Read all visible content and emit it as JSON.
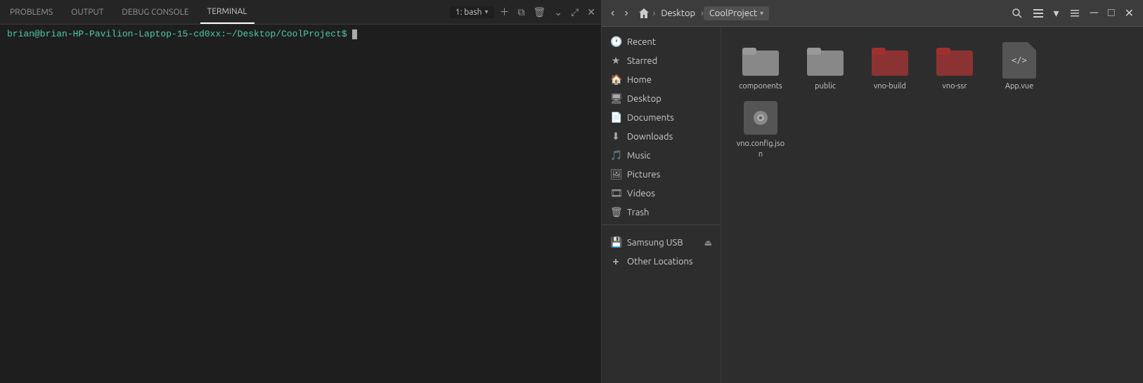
{
  "vscode": {
    "tabs": [
      {
        "label": "PROBLEMS",
        "active": false
      },
      {
        "label": "OUTPUT",
        "active": false
      },
      {
        "label": "DEBUG CONSOLE",
        "active": false
      },
      {
        "label": "TERMINAL",
        "active": true
      }
    ],
    "terminal": {
      "tab_label": "1: bash",
      "prompt": "brian@brian-HP-Pavilion-Laptop-15-cd0xx:~/Desktop/CoolProject$ "
    }
  },
  "file_manager": {
    "title": "CoolProject",
    "breadcrumbs": [
      {
        "label": "Home"
      },
      {
        "label": "Desktop"
      },
      {
        "label": "CoolProject"
      }
    ],
    "sidebar": {
      "items": [
        {
          "id": "recent",
          "icon": "🕐",
          "label": "Recent"
        },
        {
          "id": "starred",
          "icon": "★",
          "label": "Starred"
        },
        {
          "id": "home",
          "icon": "🏠",
          "label": "Home"
        },
        {
          "id": "desktop",
          "icon": "🖥",
          "label": "Desktop"
        },
        {
          "id": "documents",
          "icon": "📄",
          "label": "Documents"
        },
        {
          "id": "downloads",
          "icon": "⬇",
          "label": "Downloads"
        },
        {
          "id": "music",
          "icon": "🎵",
          "label": "Music"
        },
        {
          "id": "pictures",
          "icon": "🖼",
          "label": "Pictures"
        },
        {
          "id": "videos",
          "icon": "🎞",
          "label": "Videos"
        },
        {
          "id": "trash",
          "icon": "🗑",
          "label": "Trash"
        },
        {
          "id": "samsung-usb",
          "icon": "💾",
          "label": "Samsung USB",
          "eject": true
        },
        {
          "id": "other-locations",
          "icon": "+",
          "label": "Other Locations"
        }
      ]
    },
    "files": [
      {
        "name": "components",
        "type": "folder"
      },
      {
        "name": "public",
        "type": "folder"
      },
      {
        "name": "vno-build",
        "type": "folder-red"
      },
      {
        "name": "vno-ssr",
        "type": "folder-red"
      },
      {
        "name": "App.vue",
        "type": "vue"
      },
      {
        "name": "vno.config.json",
        "type": "json"
      }
    ]
  }
}
